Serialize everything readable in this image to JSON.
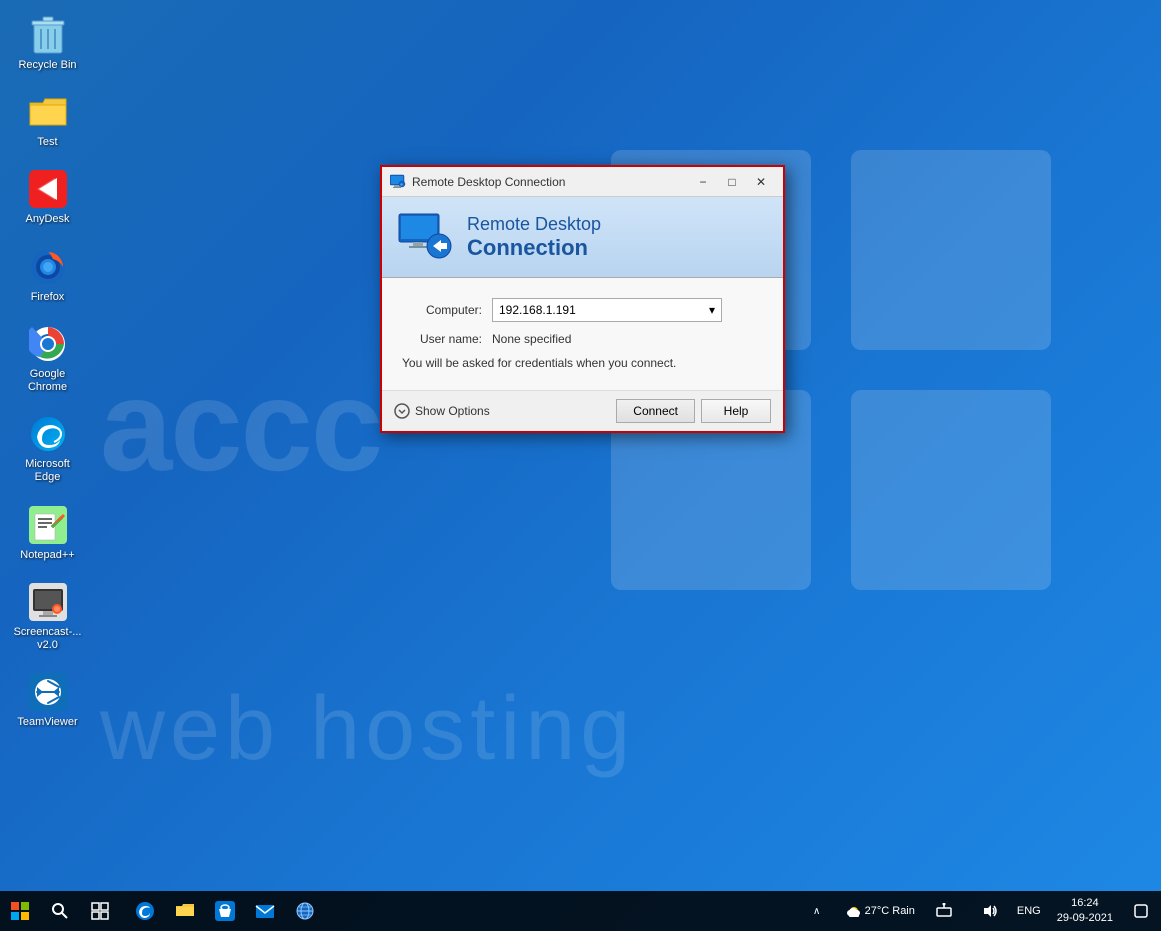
{
  "desktop": {
    "background_color": "#1565c0",
    "watermark_top": "accc",
    "watermark_bottom": "web hosting"
  },
  "icons": [
    {
      "id": "recycle-bin",
      "label": "Recycle Bin",
      "emoji": "🗑️"
    },
    {
      "id": "test",
      "label": "Test",
      "emoji": "📁"
    },
    {
      "id": "anydesk",
      "label": "AnyDesk",
      "emoji": "🔴"
    },
    {
      "id": "firefox",
      "label": "Firefox",
      "emoji": "🦊"
    },
    {
      "id": "google-chrome",
      "label": "Google Chrome",
      "emoji": "⚪"
    },
    {
      "id": "microsoft-edge",
      "label": "Microsoft Edge",
      "emoji": "🔷"
    },
    {
      "id": "notepadpp",
      "label": "Notepad++",
      "emoji": "📝"
    },
    {
      "id": "screencast",
      "label": "Screencast-...\nv2.0",
      "emoji": "🖥️"
    },
    {
      "id": "teamviewer",
      "label": "TeamViewer",
      "emoji": "↔️"
    }
  ],
  "rdp_dialog": {
    "title": "Remote Desktop Connection",
    "header_line1": "Remote Desktop",
    "header_line2": "Connection",
    "computer_label": "Computer:",
    "computer_value": "192.168.1.191",
    "username_label": "User name:",
    "username_value": "None specified",
    "info_text": "You will be asked for credentials when you connect.",
    "show_options_label": "Show Options",
    "connect_btn": "Connect",
    "help_btn": "Help",
    "minimize_btn": "−",
    "maximize_btn": "□",
    "close_btn": "✕"
  },
  "taskbar": {
    "start_icon": "⊞",
    "search_icon": "○",
    "weather": "27°C  Rain",
    "language": "ENG",
    "time": "16:24",
    "date": "29-09-2021"
  }
}
